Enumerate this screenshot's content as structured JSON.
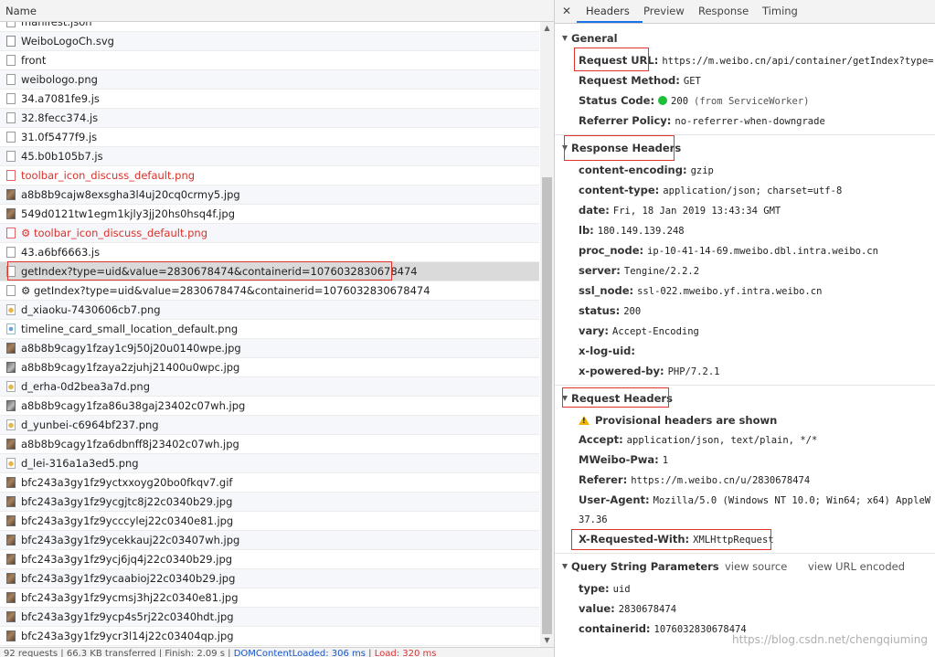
{
  "left": {
    "header": "Name",
    "files": [
      {
        "name": "manifest.json",
        "icon": "file-icon",
        "error": false
      },
      {
        "name": "WeiboLogoCh.svg",
        "icon": "svg-file-icon",
        "error": false
      },
      {
        "name": "front",
        "icon": "file-icon",
        "error": false
      },
      {
        "name": "weibologo.png",
        "icon": "file-icon",
        "error": false
      },
      {
        "name": "34.a7081fe9.js",
        "icon": "file-icon",
        "error": false
      },
      {
        "name": "32.8fecc374.js",
        "icon": "file-icon",
        "error": false
      },
      {
        "name": "31.0f5477f9.js",
        "icon": "file-icon",
        "error": false
      },
      {
        "name": "45.b0b105b7.js",
        "icon": "file-icon",
        "error": false
      },
      {
        "name": "toolbar_icon_discuss_default.png",
        "icon": "red-file-icon",
        "error": true
      },
      {
        "name": "a8b8b9cajw8exsgha3l4uj20cq0crmy5.jpg",
        "icon": "image-icon",
        "error": false
      },
      {
        "name": "549d0121tw1egm1kjly3jj20hs0hsq4f.jpg",
        "icon": "image-icon",
        "error": false
      },
      {
        "name": "⚙ toolbar_icon_discuss_default.png",
        "icon": "red-file-icon",
        "error": true
      },
      {
        "name": "43.a6bf6663.js",
        "icon": "file-icon",
        "error": false
      },
      {
        "name": "getIndex?type=uid&value=2830678474&containerid=1076032830678474",
        "icon": "file-icon",
        "error": false,
        "selected": true
      },
      {
        "name": "⚙ getIndex?type=uid&value=2830678474&containerid=1076032830678474",
        "icon": "file-icon",
        "error": false
      },
      {
        "name": "d_xiaoku-7430606cb7.png",
        "icon": "emoji-icon",
        "error": false
      },
      {
        "name": "timeline_card_small_location_default.png",
        "icon": "location-icon",
        "error": false
      },
      {
        "name": "a8b8b9cagy1fzay1c9j50j20u0140wpe.jpg",
        "icon": "image-icon",
        "error": false
      },
      {
        "name": "a8b8b9cagy1fzaya2zjuhj21400u0wpc.jpg",
        "icon": "gray-image-icon",
        "error": false
      },
      {
        "name": "d_erha-0d2bea3a7d.png",
        "icon": "emoji-icon",
        "error": false
      },
      {
        "name": "a8b8b9cagy1fza86u38gaj23402c07wh.jpg",
        "icon": "gray-image-icon",
        "error": false
      },
      {
        "name": "d_yunbei-c6964bf237.png",
        "icon": "emoji-icon",
        "error": false
      },
      {
        "name": "a8b8b9cagy1fza6dbnff8j23402c07wh.jpg",
        "icon": "image-icon",
        "error": false
      },
      {
        "name": "d_lei-316a1a3ed5.png",
        "icon": "emoji-icon",
        "error": false
      },
      {
        "name": "bfc243a3gy1fz9yctxxoyg20bo0fkqv7.gif",
        "icon": "image-icon",
        "error": false
      },
      {
        "name": "bfc243a3gy1fz9ycgjtc8j22c0340b29.jpg",
        "icon": "image-icon",
        "error": false
      },
      {
        "name": "bfc243a3gy1fz9ycccylej22c0340e81.jpg",
        "icon": "image-icon",
        "error": false
      },
      {
        "name": "bfc243a3gy1fz9ycekkauj22c03407wh.jpg",
        "icon": "image-icon",
        "error": false
      },
      {
        "name": "bfc243a3gy1fz9ycj6jq4j22c0340b29.jpg",
        "icon": "image-icon",
        "error": false
      },
      {
        "name": "bfc243a3gy1fz9ycaabioj22c0340b29.jpg",
        "icon": "image-icon",
        "error": false
      },
      {
        "name": "bfc243a3gy1fz9ycmsj3hj22c0340e81.jpg",
        "icon": "image-icon",
        "error": false
      },
      {
        "name": "bfc243a3gy1fz9ycp4s5rj22c0340hdt.jpg",
        "icon": "image-icon",
        "error": false
      },
      {
        "name": "bfc243a3gy1fz9ycr3l14j22c03404qp.jpg",
        "icon": "image-icon",
        "error": false
      }
    ],
    "status": {
      "prefix": "92 requests | 66.3 KB transferred | Finish: 2.09 s | ",
      "domcontent": "DOMContentLoaded: 306 ms",
      "sep": " | ",
      "load": "Load: 320 ms"
    }
  },
  "right": {
    "tabs": [
      "Headers",
      "Preview",
      "Response",
      "Timing"
    ],
    "active_tab": "Headers",
    "close_glyph": "✕",
    "general": {
      "title": "General",
      "request_url_label": "Request URL:",
      "request_url": "https://m.weibo.cn/api/container/getIndex?type=",
      "request_method_label": "Request Method:",
      "request_method": "GET",
      "status_code_label": "Status Code:",
      "status_code": "200",
      "status_extra": "(from ServiceWorker)",
      "referrer_policy_label": "Referrer Policy:",
      "referrer_policy": "no-referrer-when-downgrade"
    },
    "response_headers": {
      "title": "Response Headers",
      "items": [
        {
          "k": "content-encoding:",
          "v": "gzip"
        },
        {
          "k": "content-type:",
          "v": "application/json; charset=utf-8"
        },
        {
          "k": "date:",
          "v": "Fri, 18 Jan 2019 13:43:34 GMT"
        },
        {
          "k": "lb:",
          "v": "180.149.139.248"
        },
        {
          "k": "proc_node:",
          "v": "ip-10-41-14-69.mweibo.dbl.intra.weibo.cn"
        },
        {
          "k": "server:",
          "v": "Tengine/2.2.2"
        },
        {
          "k": "ssl_node:",
          "v": "ssl-022.mweibo.yf.intra.weibo.cn"
        },
        {
          "k": "status:",
          "v": "200"
        },
        {
          "k": "vary:",
          "v": "Accept-Encoding"
        },
        {
          "k": "x-log-uid:",
          "v": ""
        },
        {
          "k": "x-powered-by:",
          "v": "PHP/7.2.1"
        }
      ]
    },
    "request_headers": {
      "title": "Request Headers",
      "warning": "Provisional headers are shown",
      "items": [
        {
          "k": "Accept:",
          "v": "application/json, text/plain, */*"
        },
        {
          "k": "MWeibo-Pwa:",
          "v": "1"
        },
        {
          "k": "Referer:",
          "v": "https://m.weibo.cn/u/2830678474"
        },
        {
          "k": "User-Agent:",
          "v": "Mozilla/5.0 (Windows NT 10.0; Win64; x64) AppleW"
        }
      ],
      "ua_continued": "37.36",
      "x_requested_with_label": "X-Requested-With:",
      "x_requested_with": "XMLHttpRequest"
    },
    "query_string": {
      "title": "Query String Parameters",
      "view_source": "view source",
      "view_url_encoded": "view URL encoded",
      "items": [
        {
          "k": "type:",
          "v": "uid"
        },
        {
          "k": "value:",
          "v": "2830678474"
        },
        {
          "k": "containerid:",
          "v": "1076032830678474"
        }
      ]
    },
    "watermark": "https://blog.csdn.net/chengqiuming"
  },
  "colors": {
    "error_red": "#d9312a",
    "highlight_box": "#e0332b",
    "status_ok_green": "#1dbf3a",
    "tab_underline": "#1a73e8"
  }
}
